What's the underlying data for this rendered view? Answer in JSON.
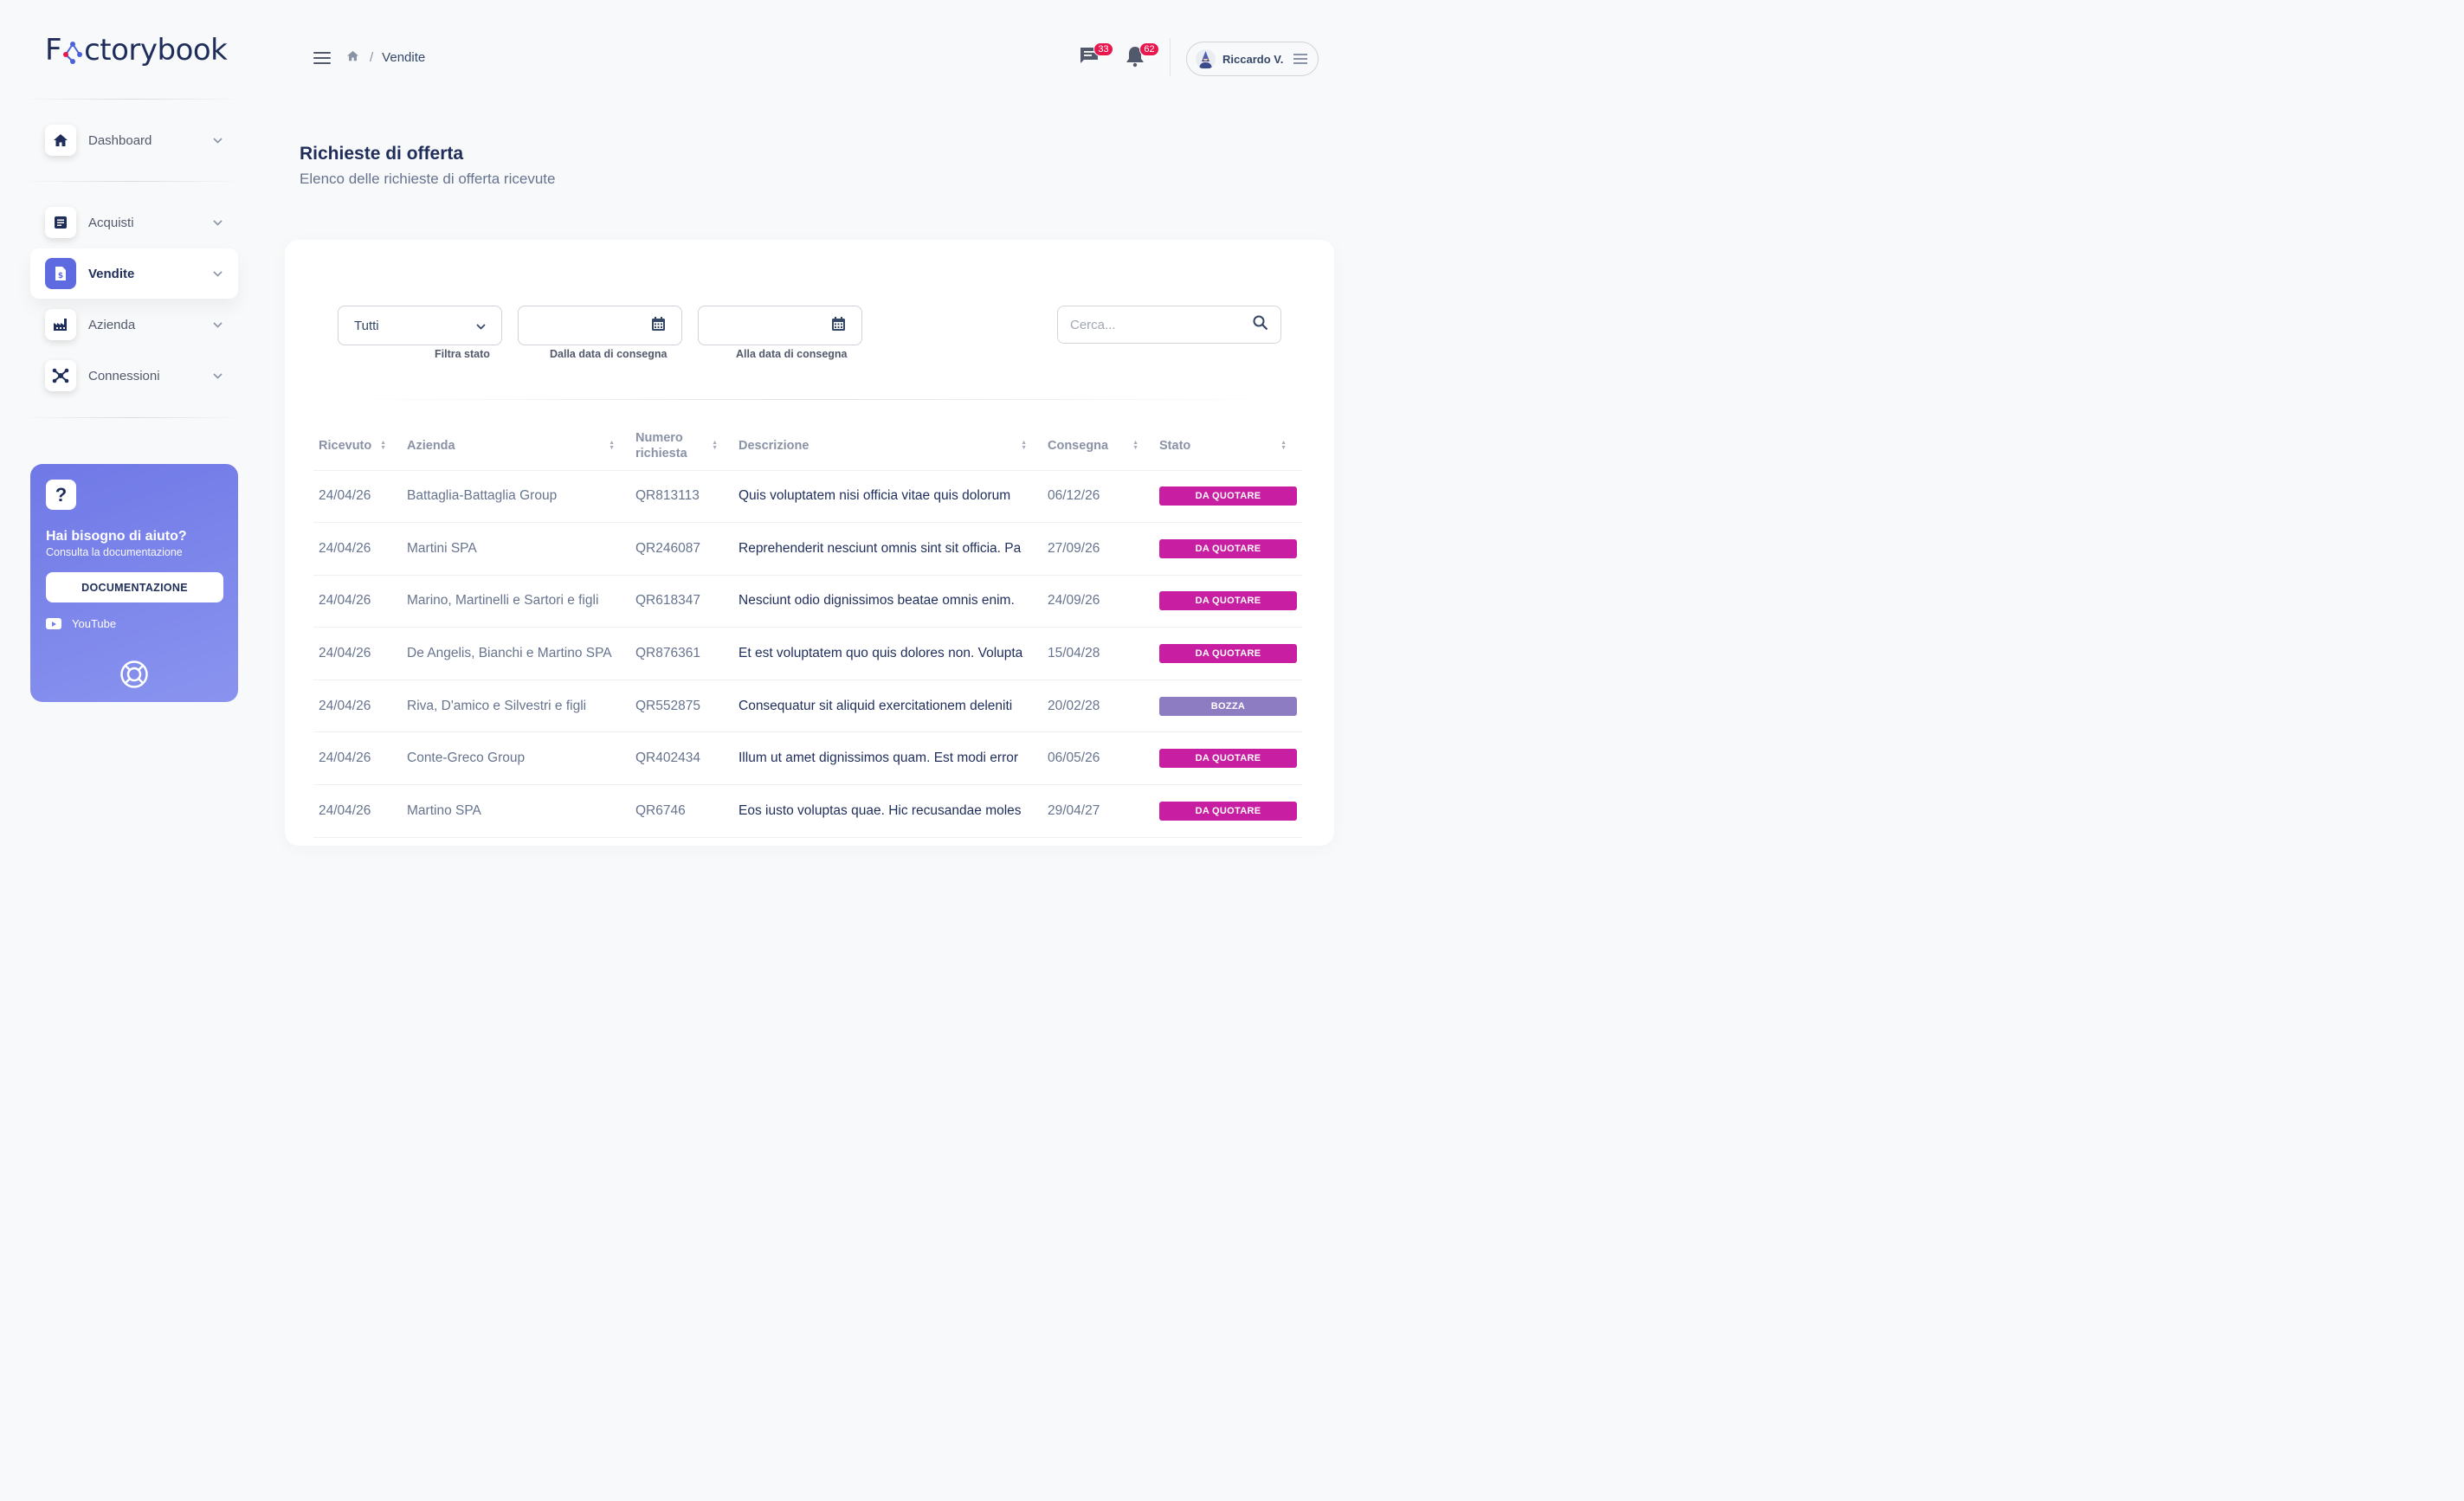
{
  "brand": {
    "name": "Factorybook",
    "logo_pre": "F",
    "logo_post": "ctorybook"
  },
  "colors": {
    "accent": "#5e6ae0",
    "badge": "#e8174d",
    "status_quote": "#c81ea2",
    "status_draft": "#8e7cc3"
  },
  "sidebar": {
    "items": [
      {
        "label": "Dashboard",
        "icon": "home-icon"
      },
      {
        "label": "Acquisti",
        "icon": "document-icon"
      },
      {
        "label": "Vendite",
        "icon": "invoice-dollar-icon",
        "active": true
      },
      {
        "label": "Azienda",
        "icon": "factory-icon"
      },
      {
        "label": "Connessioni",
        "icon": "network-icon"
      }
    ],
    "help": {
      "icon_glyph": "?",
      "title": "Hai bisogno di aiuto?",
      "subtitle": "Consulta la documentazione",
      "doc_button": "DOCUMENTAZIONE",
      "youtube": "YouTube"
    }
  },
  "header": {
    "breadcrumb": {
      "separator": "/",
      "current": "Vendite"
    },
    "messages_count": "33",
    "notifications_count": "62",
    "user_name": "Riccardo V."
  },
  "page": {
    "title": "Richieste di offerta",
    "subtitle": "Elenco delle richieste di offerta ricevute"
  },
  "filters": {
    "status_value": "Tutti",
    "status_label": "Filtra stato",
    "from_label": "Dalla data di consegna",
    "to_label": "Alla data di consegna",
    "search_placeholder": "Cerca..."
  },
  "table": {
    "columns": [
      "Ricevuto",
      "Azienda",
      "Numero richiesta",
      "Descrizione",
      "Consegna",
      "Stato"
    ],
    "rows": [
      {
        "ricevuto": "24/04/26",
        "azienda": "Battaglia-Battaglia Group",
        "numero": "QR813113",
        "descrizione": "Quis voluptatem nisi officia vitae quis dolorum",
        "consegna": "06/12/26",
        "stato": "DA QUOTARE"
      },
      {
        "ricevuto": "24/04/26",
        "azienda": "Martini SPA",
        "numero": "QR246087",
        "descrizione": "Reprehenderit nesciunt omnis sint sit officia. Pa",
        "consegna": "27/09/26",
        "stato": "DA QUOTARE"
      },
      {
        "ricevuto": "24/04/26",
        "azienda": "Marino, Martinelli e Sartori e figli",
        "numero": "QR618347",
        "descrizione": "Nesciunt odio dignissimos beatae omnis enim.",
        "consegna": "24/09/26",
        "stato": "DA QUOTARE"
      },
      {
        "ricevuto": "24/04/26",
        "azienda": "De Angelis, Bianchi e Martino SPA",
        "numero": "QR876361",
        "descrizione": "Et est voluptatem quo quis dolores non. Volupta",
        "consegna": "15/04/28",
        "stato": "DA QUOTARE"
      },
      {
        "ricevuto": "24/04/26",
        "azienda": "Riva, D'amico e Silvestri e figli",
        "numero": "QR552875",
        "descrizione": "Consequatur sit aliquid exercitationem deleniti",
        "consegna": "20/02/28",
        "stato": "BOZZA"
      },
      {
        "ricevuto": "24/04/26",
        "azienda": "Conte-Greco Group",
        "numero": "QR402434",
        "descrizione": "Illum ut amet dignissimos quam. Est modi error",
        "consegna": "06/05/26",
        "stato": "DA QUOTARE"
      },
      {
        "ricevuto": "24/04/26",
        "azienda": "Martino SPA",
        "numero": "QR6746",
        "descrizione": "Eos iusto voluptas quae. Hic recusandae moles",
        "consegna": "29/04/27",
        "stato": "DA QUOTARE"
      }
    ]
  }
}
